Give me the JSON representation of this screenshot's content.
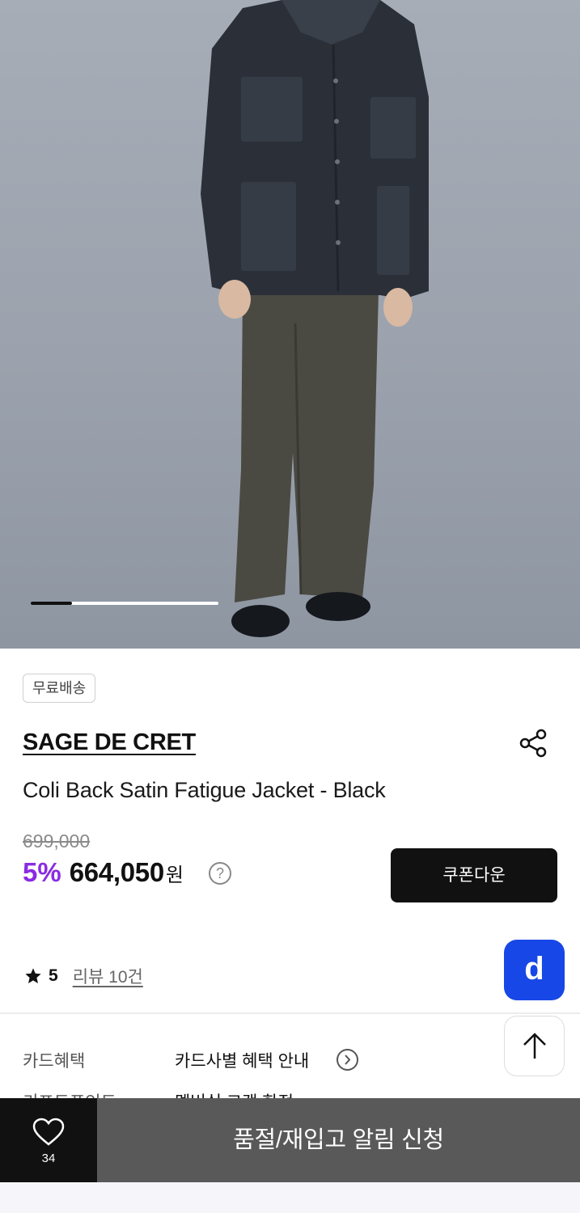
{
  "gallery": {
    "progress": 0.22
  },
  "product": {
    "badge": "무료배송",
    "brand": "SAGE DE CRET",
    "name": "Coli Back Satin Fatigue Jacket - Black",
    "original_price": "699,000",
    "discount": "5%",
    "sale_price": "664,050",
    "currency": "원",
    "help_glyph": "?",
    "coupon_label": "쿠폰다운",
    "rating": "5",
    "review_link": "리뷰 10건"
  },
  "floating": {
    "d_label": "d"
  },
  "info": {
    "card_label": "카드혜택",
    "card_value": "카드사별 혜택 안내",
    "point_label": "키프트포인트",
    "point_value": "멤버십 고객 한정"
  },
  "bottom": {
    "wish_count": "34",
    "notify_label": "품절/재입고 알림 신청"
  },
  "colors": {
    "discount": "#8a2be2",
    "d_button": "#1747e6",
    "bottom_bar": "#595959"
  }
}
